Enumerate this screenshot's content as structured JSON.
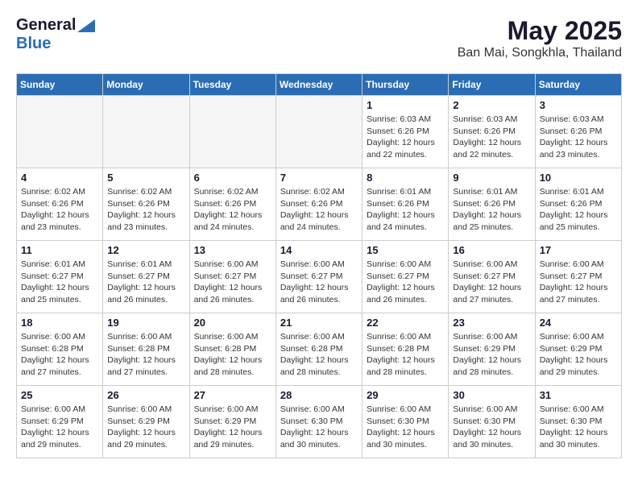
{
  "header": {
    "logo_general": "General",
    "logo_blue": "Blue",
    "month_year": "May 2025",
    "location": "Ban Mai, Songkhla, Thailand"
  },
  "weekdays": [
    "Sunday",
    "Monday",
    "Tuesday",
    "Wednesday",
    "Thursday",
    "Friday",
    "Saturday"
  ],
  "weeks": [
    [
      {
        "day": "",
        "info": ""
      },
      {
        "day": "",
        "info": ""
      },
      {
        "day": "",
        "info": ""
      },
      {
        "day": "",
        "info": ""
      },
      {
        "day": "1",
        "info": "Sunrise: 6:03 AM\nSunset: 6:26 PM\nDaylight: 12 hours\nand 22 minutes."
      },
      {
        "day": "2",
        "info": "Sunrise: 6:03 AM\nSunset: 6:26 PM\nDaylight: 12 hours\nand 22 minutes."
      },
      {
        "day": "3",
        "info": "Sunrise: 6:03 AM\nSunset: 6:26 PM\nDaylight: 12 hours\nand 23 minutes."
      }
    ],
    [
      {
        "day": "4",
        "info": "Sunrise: 6:02 AM\nSunset: 6:26 PM\nDaylight: 12 hours\nand 23 minutes."
      },
      {
        "day": "5",
        "info": "Sunrise: 6:02 AM\nSunset: 6:26 PM\nDaylight: 12 hours\nand 23 minutes."
      },
      {
        "day": "6",
        "info": "Sunrise: 6:02 AM\nSunset: 6:26 PM\nDaylight: 12 hours\nand 24 minutes."
      },
      {
        "day": "7",
        "info": "Sunrise: 6:02 AM\nSunset: 6:26 PM\nDaylight: 12 hours\nand 24 minutes."
      },
      {
        "day": "8",
        "info": "Sunrise: 6:01 AM\nSunset: 6:26 PM\nDaylight: 12 hours\nand 24 minutes."
      },
      {
        "day": "9",
        "info": "Sunrise: 6:01 AM\nSunset: 6:26 PM\nDaylight: 12 hours\nand 25 minutes."
      },
      {
        "day": "10",
        "info": "Sunrise: 6:01 AM\nSunset: 6:26 PM\nDaylight: 12 hours\nand 25 minutes."
      }
    ],
    [
      {
        "day": "11",
        "info": "Sunrise: 6:01 AM\nSunset: 6:27 PM\nDaylight: 12 hours\nand 25 minutes."
      },
      {
        "day": "12",
        "info": "Sunrise: 6:01 AM\nSunset: 6:27 PM\nDaylight: 12 hours\nand 26 minutes."
      },
      {
        "day": "13",
        "info": "Sunrise: 6:00 AM\nSunset: 6:27 PM\nDaylight: 12 hours\nand 26 minutes."
      },
      {
        "day": "14",
        "info": "Sunrise: 6:00 AM\nSunset: 6:27 PM\nDaylight: 12 hours\nand 26 minutes."
      },
      {
        "day": "15",
        "info": "Sunrise: 6:00 AM\nSunset: 6:27 PM\nDaylight: 12 hours\nand 26 minutes."
      },
      {
        "day": "16",
        "info": "Sunrise: 6:00 AM\nSunset: 6:27 PM\nDaylight: 12 hours\nand 27 minutes."
      },
      {
        "day": "17",
        "info": "Sunrise: 6:00 AM\nSunset: 6:27 PM\nDaylight: 12 hours\nand 27 minutes."
      }
    ],
    [
      {
        "day": "18",
        "info": "Sunrise: 6:00 AM\nSunset: 6:28 PM\nDaylight: 12 hours\nand 27 minutes."
      },
      {
        "day": "19",
        "info": "Sunrise: 6:00 AM\nSunset: 6:28 PM\nDaylight: 12 hours\nand 27 minutes."
      },
      {
        "day": "20",
        "info": "Sunrise: 6:00 AM\nSunset: 6:28 PM\nDaylight: 12 hours\nand 28 minutes."
      },
      {
        "day": "21",
        "info": "Sunrise: 6:00 AM\nSunset: 6:28 PM\nDaylight: 12 hours\nand 28 minutes."
      },
      {
        "day": "22",
        "info": "Sunrise: 6:00 AM\nSunset: 6:28 PM\nDaylight: 12 hours\nand 28 minutes."
      },
      {
        "day": "23",
        "info": "Sunrise: 6:00 AM\nSunset: 6:29 PM\nDaylight: 12 hours\nand 28 minutes."
      },
      {
        "day": "24",
        "info": "Sunrise: 6:00 AM\nSunset: 6:29 PM\nDaylight: 12 hours\nand 29 minutes."
      }
    ],
    [
      {
        "day": "25",
        "info": "Sunrise: 6:00 AM\nSunset: 6:29 PM\nDaylight: 12 hours\nand 29 minutes."
      },
      {
        "day": "26",
        "info": "Sunrise: 6:00 AM\nSunset: 6:29 PM\nDaylight: 12 hours\nand 29 minutes."
      },
      {
        "day": "27",
        "info": "Sunrise: 6:00 AM\nSunset: 6:29 PM\nDaylight: 12 hours\nand 29 minutes."
      },
      {
        "day": "28",
        "info": "Sunrise: 6:00 AM\nSunset: 6:30 PM\nDaylight: 12 hours\nand 30 minutes."
      },
      {
        "day": "29",
        "info": "Sunrise: 6:00 AM\nSunset: 6:30 PM\nDaylight: 12 hours\nand 30 minutes."
      },
      {
        "day": "30",
        "info": "Sunrise: 6:00 AM\nSunset: 6:30 PM\nDaylight: 12 hours\nand 30 minutes."
      },
      {
        "day": "31",
        "info": "Sunrise: 6:00 AM\nSunset: 6:30 PM\nDaylight: 12 hours\nand 30 minutes."
      }
    ]
  ]
}
